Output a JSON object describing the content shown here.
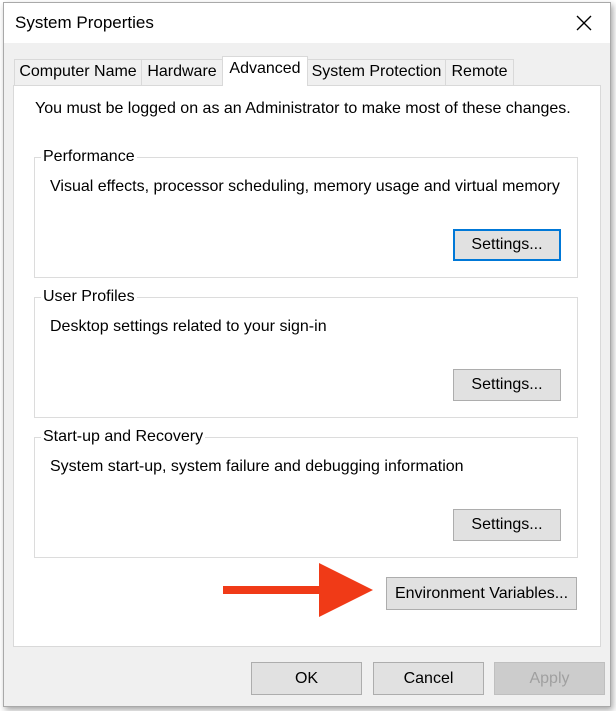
{
  "window": {
    "title": "System Properties",
    "close_icon": "close-icon"
  },
  "tabs": [
    {
      "label": "Computer Name",
      "active": false
    },
    {
      "label": "Hardware",
      "active": false
    },
    {
      "label": "Advanced",
      "active": true
    },
    {
      "label": "System Protection",
      "active": false
    },
    {
      "label": "Remote",
      "active": false
    }
  ],
  "advanced": {
    "intro": "You must be logged on as an Administrator to make most of these changes.",
    "performance": {
      "title": "Performance",
      "description": "Visual effects, processor scheduling, memory usage and virtual memory",
      "button": "Settings..."
    },
    "user_profiles": {
      "title": "User Profiles",
      "description": "Desktop settings related to your sign-in",
      "button": "Settings..."
    },
    "startup_recovery": {
      "title": "Start-up and Recovery",
      "description": "System start-up, system failure and debugging information",
      "button": "Settings..."
    },
    "env_button": "Environment Variables..."
  },
  "footer": {
    "ok": "OK",
    "cancel": "Cancel",
    "apply": "Apply"
  },
  "colors": {
    "arrow": "#f03a17",
    "focus_border": "#0078d7",
    "dialog_bg": "#f0f0f0"
  },
  "annotation": {
    "icon": "red-arrow-icon"
  }
}
